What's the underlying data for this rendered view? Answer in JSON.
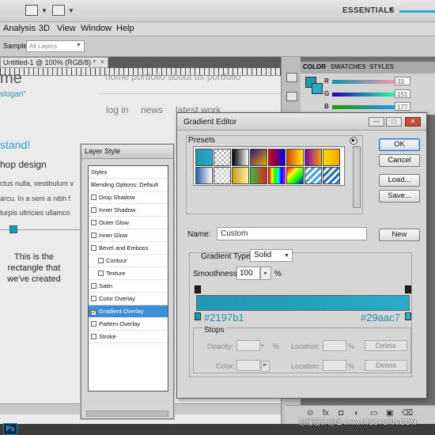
{
  "workspace": {
    "label": "ESSENTIALS"
  },
  "menu": {
    "items": [
      "Analysis",
      "3D",
      "View",
      "Window",
      "Help"
    ]
  },
  "options": {
    "sample_label": "Sample:",
    "sample_value": "All Layers"
  },
  "document": {
    "tab_title": "Untitled-1 @ 100% (RGB/8) *",
    "close_glyph": "×"
  },
  "canvas": {
    "logo": "me",
    "slogan": "slogan\"",
    "nav_top": "home   portfolio   about us   portfolio",
    "nav": [
      "log in",
      "news",
      "latest work"
    ],
    "heading": "stand!",
    "subheading": "hop design",
    "lorem": [
      "ctus nulla, vestibulum v",
      "arcu. In a sem a nibh f",
      "turpis ultricies ullamco"
    ],
    "caption": "This is the rectangle that we've created"
  },
  "panels": {
    "tabs": [
      "COLOR",
      "SWATCHES",
      "STYLES"
    ],
    "color": {
      "sliders": [
        {
          "label": "R",
          "value": "33"
        },
        {
          "label": "G",
          "value": "151"
        },
        {
          "label": "B",
          "value": "177"
        }
      ]
    }
  },
  "layer_style": {
    "title": "Layer Style",
    "items": [
      {
        "label": "Styles",
        "checkbox": false,
        "checked": false,
        "selected": false,
        "indent": false
      },
      {
        "label": "Blending Options: Default",
        "checkbox": false,
        "checked": false,
        "selected": false,
        "indent": false
      },
      {
        "label": "Drop Shadow",
        "checkbox": true,
        "checked": false,
        "selected": false,
        "indent": false
      },
      {
        "label": "Inner Shadow",
        "checkbox": true,
        "checked": false,
        "selected": false,
        "indent": false
      },
      {
        "label": "Outer Glow",
        "checkbox": true,
        "checked": false,
        "selected": false,
        "indent": false
      },
      {
        "label": "Inner Glow",
        "checkbox": true,
        "checked": false,
        "selected": false,
        "indent": false
      },
      {
        "label": "Bevel and Emboss",
        "checkbox": true,
        "checked": false,
        "selected": false,
        "indent": false
      },
      {
        "label": "Contour",
        "checkbox": true,
        "checked": false,
        "selected": false,
        "indent": true
      },
      {
        "label": "Texture",
        "checkbox": true,
        "checked": false,
        "selected": false,
        "indent": true
      },
      {
        "label": "Satin",
        "checkbox": true,
        "checked": false,
        "selected": false,
        "indent": false
      },
      {
        "label": "Color Overlay",
        "checkbox": true,
        "checked": false,
        "selected": false,
        "indent": false
      },
      {
        "label": "Gradient Overlay",
        "checkbox": true,
        "checked": true,
        "selected": true,
        "indent": false
      },
      {
        "label": "Pattern Overlay",
        "checkbox": true,
        "checked": false,
        "selected": false,
        "indent": false
      },
      {
        "label": "Stroke",
        "checkbox": true,
        "checked": false,
        "selected": false,
        "indent": false
      }
    ]
  },
  "gradient_editor": {
    "title": "Gradient Editor",
    "presets_label": "Presets",
    "buttons": {
      "ok": "OK",
      "cancel": "Cancel",
      "load": "Load...",
      "save": "Save...",
      "new": "New"
    },
    "name_label": "Name:",
    "name_value": "Custom",
    "type_label": "Gradient Type:",
    "type_value": "Solid",
    "smoothness_label": "Smoothness:",
    "smoothness_value": "100",
    "percent": "%",
    "start_color": "#2197b1",
    "end_color": "#29aac7",
    "stops": {
      "label": "Stops",
      "opacity_label": "Opacity:",
      "color_label": "Color:",
      "location_label": "Location:",
      "delete_label": "Delete"
    }
  },
  "watermark": "思缘设计论坛  www.MISSYUAN.COM"
}
